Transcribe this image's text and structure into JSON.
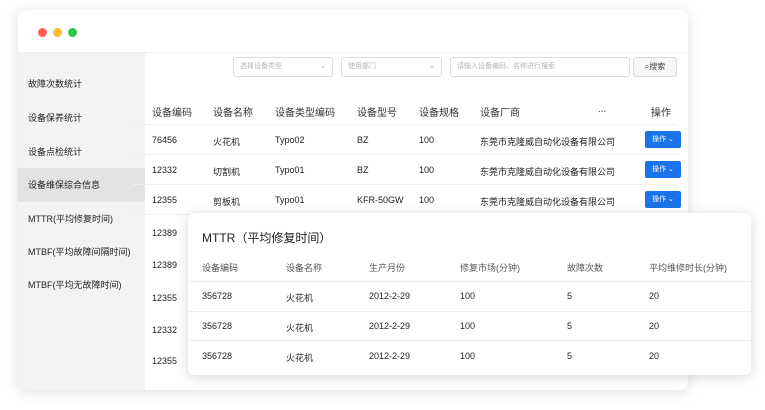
{
  "sidebar": {
    "items": [
      {
        "label": "故障次数统计",
        "active": false
      },
      {
        "label": "设备保养统计",
        "active": false
      },
      {
        "label": "设备点检统计",
        "active": false
      },
      {
        "label": "设备维保综合信息",
        "active": true
      },
      {
        "label": "MTTR(平均修复时间)",
        "active": false
      },
      {
        "label": "MTBF(平均故障间隔时间)",
        "active": false
      },
      {
        "label": "MTBF(平均无故障时间)",
        "active": false
      }
    ]
  },
  "filters": {
    "type_placeholder": "选择设备类型",
    "dept_placeholder": "使用部门",
    "search_placeholder": "请输入设备编码、名称进行搜索",
    "search_button": "搜索"
  },
  "table": {
    "headers": [
      "设备编码",
      "设备名称",
      "设备类型编码",
      "设备型号",
      "设备规格",
      "设备厂商",
      "...",
      "操作"
    ],
    "rows": [
      {
        "code": "76456",
        "name": "火花机",
        "type": "Typo02",
        "model": "BZ",
        "spec": "100",
        "vendor": "东莞市克隆威自动化设备有限公司",
        "op": "操作"
      },
      {
        "code": "12332",
        "name": "切割机",
        "type": "Typo01",
        "model": "BZ",
        "spec": "100",
        "vendor": "东莞市克隆威自动化设备有限公司",
        "op": "操作"
      },
      {
        "code": "12355",
        "name": "剪板机",
        "type": "Typo01",
        "model": "KFR-50GW",
        "spec": "100",
        "vendor": "东莞市克隆威自动化设备有限公司",
        "op": "操作"
      }
    ],
    "partial_codes": [
      "12389",
      "12389",
      "12355",
      "12332",
      "12355"
    ]
  },
  "mttr_card": {
    "title": "MTTR（平均修复时间）",
    "headers": [
      "设备编码",
      "设备名称",
      "生产月份",
      "修复市场(分钟)",
      "故障次数",
      "平均维修时长(分钟)"
    ],
    "rows": [
      {
        "code": "356728",
        "name": "火花机",
        "month": "2012-2-29",
        "repair": "100",
        "faults": "5",
        "avg": "20"
      },
      {
        "code": "356728",
        "name": "火花机",
        "month": "2012-2-29",
        "repair": "100",
        "faults": "5",
        "avg": "20"
      },
      {
        "code": "356728",
        "name": "火花机",
        "month": "2012-2-29",
        "repair": "100",
        "faults": "5",
        "avg": "20"
      }
    ]
  },
  "colors": {
    "accent": "#1a73e8",
    "dot_red": "#ff5f57",
    "dot_yellow": "#febc2e",
    "dot_green": "#28c840"
  }
}
